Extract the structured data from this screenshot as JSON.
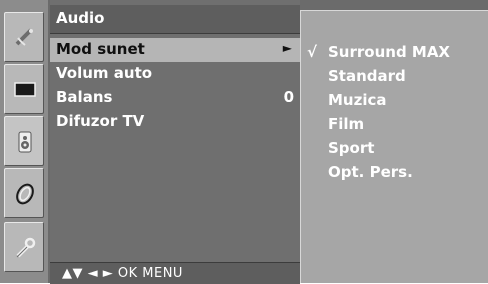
{
  "menu": {
    "title": "Audio",
    "items": [
      {
        "label": "Mod sunet",
        "value": "",
        "arrow": "►"
      },
      {
        "label": "Volum auto",
        "value": ""
      },
      {
        "label": "Balans",
        "value": "0"
      },
      {
        "label": "Difuzor TV",
        "value": ""
      }
    ],
    "nav_hint": "▲▼  ◄ ►  OK  MENU"
  },
  "submenu": {
    "check_mark": "√",
    "options": [
      "Surround MAX",
      "Standard",
      "Muzica",
      "Film",
      "Sport",
      "Opt. Pers."
    ],
    "selected_index": 0
  },
  "rail": {
    "icons": [
      "satellite-dish-icon",
      "picture-icon",
      "speaker-icon",
      "clock-icon",
      "wrench-icon"
    ],
    "active_index": 2
  },
  "colors": {
    "menu_bg": "#6f6f6f",
    "highlight": "#b5b5b5",
    "submenu_bg": "#a6a6a6",
    "text": "#ffffff"
  }
}
